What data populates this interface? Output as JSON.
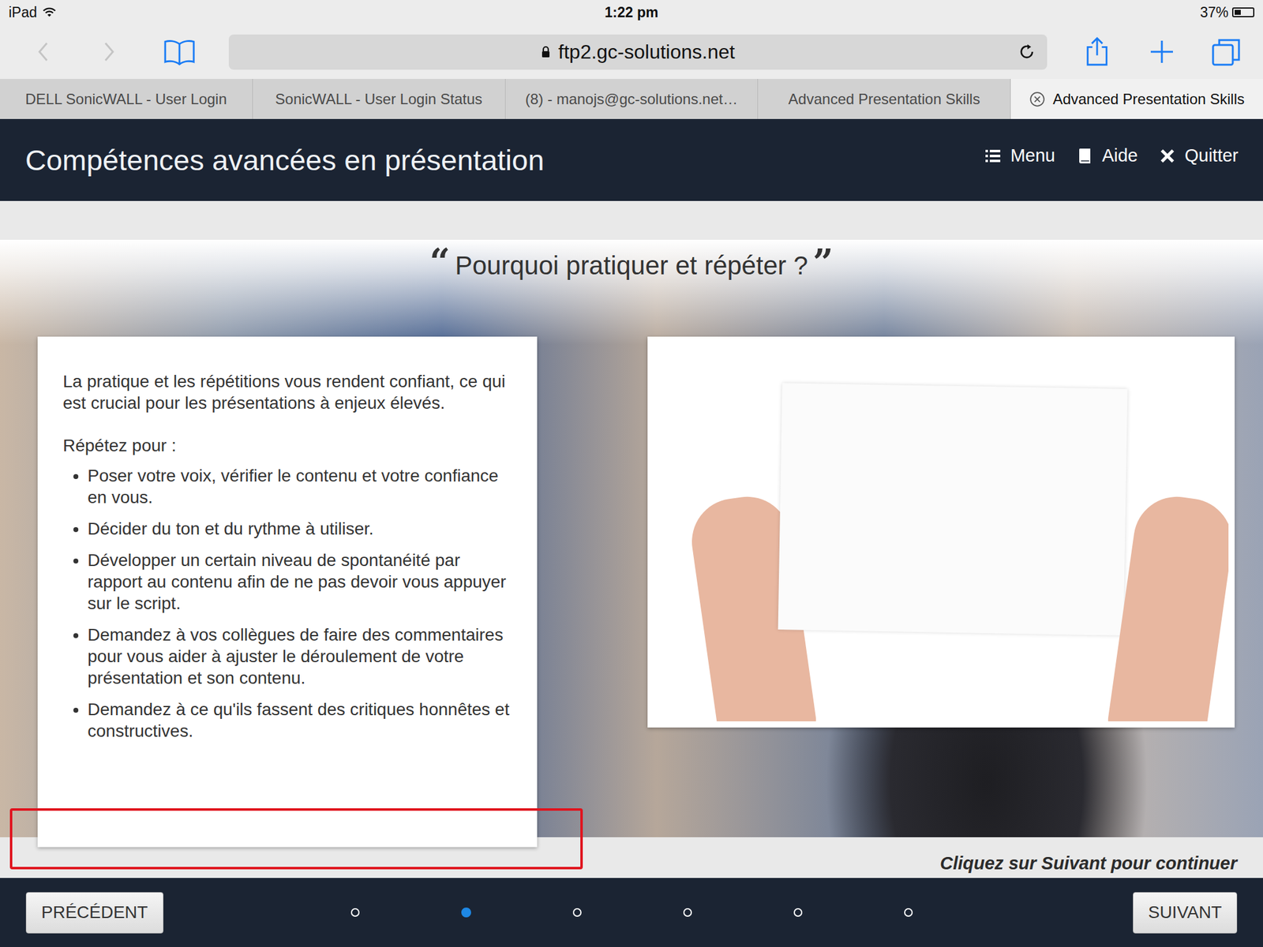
{
  "status_bar": {
    "device": "iPad",
    "time": "1:22 pm",
    "battery": "37%",
    "battery_level": 0.37
  },
  "browser": {
    "back_disabled": true,
    "forward_disabled": true,
    "url": "ftp2.gc-solutions.net"
  },
  "tabs": [
    {
      "label": "DELL SonicWALL - User Login",
      "selected": false
    },
    {
      "label": "SonicWALL - User Login Status",
      "selected": false
    },
    {
      "label": "(8) - manojs@gc-solutions.net…",
      "selected": false
    },
    {
      "label": "Advanced Presentation Skills",
      "selected": false
    },
    {
      "label": "Advanced Presentation Skills",
      "selected": true
    }
  ],
  "course": {
    "title": "Compétences avancées en présentation",
    "nav": [
      {
        "label": "Menu",
        "kind": "menu"
      },
      {
        "label": "Aide",
        "kind": "help"
      },
      {
        "label": "Quitter",
        "kind": "quit"
      }
    ]
  },
  "slide": {
    "open_quote": "“",
    "heading": "Pourquoi pratiquer et répéter ?",
    "close_quote": "”",
    "intro": "La pratique et les répétitions vous rendent confiant, ce qui est crucial pour les présentations à enjeux élevés.",
    "subhead": "Répétez pour :",
    "bullets": [
      "Poser votre voix, vérifier le contenu et votre confiance en vous.",
      "Décider du ton et du rythme à utiliser.",
      "Développer un certain niveau de spontanéité par rapport au contenu afin de ne pas devoir vous appuyer sur le script.",
      "Demandez à vos collègues de faire des commentaires pour vous aider à ajuster le déroulement de votre présentation et son contenu.",
      "Demandez à ce qu'ils fassent des critiques honnêtes et constructives."
    ]
  },
  "hint": "Cliquez sur Suivant pour continuer",
  "footer": {
    "previous": "PRÉCÉDENT",
    "next": "SUIVANT",
    "pages": [
      {
        "selected": false
      },
      {
        "selected": true
      },
      {
        "selected": false
      },
      {
        "selected": false
      },
      {
        "selected": false
      },
      {
        "selected": false
      }
    ]
  }
}
